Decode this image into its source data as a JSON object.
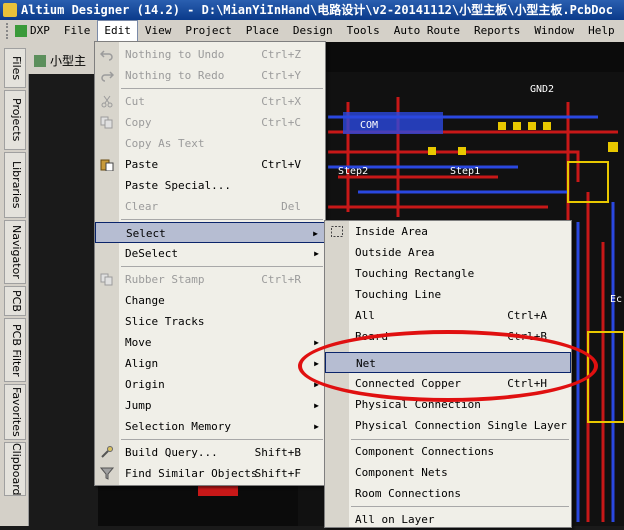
{
  "window": {
    "title": "Altium Designer (14.2) - D:\\MianYiInHand\\电路设计\\v2-20141112\\小型主板\\小型主板.PcbDoc"
  },
  "menubar": {
    "items": [
      {
        "label": "DXP"
      },
      {
        "label": "File"
      },
      {
        "label": "Edit"
      },
      {
        "label": "View"
      },
      {
        "label": "Project"
      },
      {
        "label": "Place"
      },
      {
        "label": "Design"
      },
      {
        "label": "Tools"
      },
      {
        "label": "Auto Route"
      },
      {
        "label": "Reports"
      },
      {
        "label": "Window"
      },
      {
        "label": "Help"
      }
    ]
  },
  "leftdock": {
    "tabs": [
      "Files",
      "Projects",
      "Libraries",
      "Navigator",
      "PCB",
      "PCB Filter",
      "Favorites",
      "Clipboard"
    ]
  },
  "doctab": {
    "label": "小型主"
  },
  "pcb": {
    "labels": [
      "GND2",
      "COM",
      "Step2",
      "Step1",
      "Ec"
    ]
  },
  "edit_menu": {
    "items": [
      {
        "label": "Nothing to Undo",
        "shortcut": "Ctrl+Z"
      },
      {
        "label": "Nothing to Redo",
        "shortcut": "Ctrl+Y"
      },
      {
        "label": "Cut",
        "shortcut": "Ctrl+X"
      },
      {
        "label": "Copy",
        "shortcut": "Ctrl+C"
      },
      {
        "label": "Copy As Text",
        "shortcut": ""
      },
      {
        "label": "Paste",
        "shortcut": "Ctrl+V"
      },
      {
        "label": "Paste Special...",
        "shortcut": ""
      },
      {
        "label": "Clear",
        "shortcut": "Del"
      },
      {
        "label": "Select",
        "shortcut": ""
      },
      {
        "label": "DeSelect",
        "shortcut": ""
      },
      {
        "label": "Rubber Stamp",
        "shortcut": "Ctrl+R"
      },
      {
        "label": "Change",
        "shortcut": ""
      },
      {
        "label": "Slice Tracks",
        "shortcut": ""
      },
      {
        "label": "Move",
        "shortcut": ""
      },
      {
        "label": "Align",
        "shortcut": ""
      },
      {
        "label": "Origin",
        "shortcut": ""
      },
      {
        "label": "Jump",
        "shortcut": ""
      },
      {
        "label": "Selection Memory",
        "shortcut": ""
      },
      {
        "label": "Build Query...",
        "shortcut": "Shift+B"
      },
      {
        "label": "Find Similar Objects",
        "shortcut": "Shift+F"
      }
    ]
  },
  "select_menu": {
    "items": [
      {
        "label": "Inside Area",
        "shortcut": ""
      },
      {
        "label": "Outside Area",
        "shortcut": ""
      },
      {
        "label": "Touching Rectangle",
        "shortcut": ""
      },
      {
        "label": "Touching Line",
        "shortcut": ""
      },
      {
        "label": "All",
        "shortcut": "Ctrl+A"
      },
      {
        "label": "Board",
        "shortcut": "Ctrl+B"
      },
      {
        "label": "Net",
        "shortcut": ""
      },
      {
        "label": "Connected Copper",
        "shortcut": "Ctrl+H"
      },
      {
        "label": "Physical Connection",
        "shortcut": ""
      },
      {
        "label": "Physical Connection Single Layer",
        "shortcut": ""
      },
      {
        "label": "Component Connections",
        "shortcut": ""
      },
      {
        "label": "Component Nets",
        "shortcut": ""
      },
      {
        "label": "Room Connections",
        "shortcut": ""
      },
      {
        "label": "All on Layer",
        "shortcut": ""
      }
    ]
  },
  "colors": {
    "titlebar": "#0a3a8a",
    "menu_bg": "#f0efe8",
    "highlight": "#b6bdd2",
    "annotation": "#e01010",
    "pcb_bg": "#0b0b0b"
  }
}
